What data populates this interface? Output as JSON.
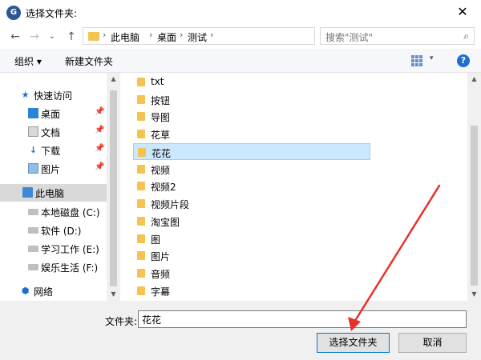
{
  "window": {
    "title": "选择文件夹:",
    "app_icon": "app-logo-icon",
    "close_glyph": "✕"
  },
  "nav": {
    "back": "←",
    "forward": "→",
    "recent": "⌄",
    "up": "↑"
  },
  "address": {
    "crumbs": [
      "此电脑",
      "桌面",
      "测试"
    ],
    "separator": "›",
    "dropdown": "⌄",
    "refresh": "↻"
  },
  "search": {
    "placeholder": "搜索\"测试\"",
    "icon": "⌕"
  },
  "toolbar": {
    "organize": "组织 ▾",
    "new_folder": "新建文件夹",
    "view_drop": "▾",
    "help": "?"
  },
  "sidebar": {
    "items": [
      {
        "label": "快速访问",
        "icon": "★"
      },
      {
        "label": "桌面",
        "icon": ""
      },
      {
        "label": "文档",
        "icon": ""
      },
      {
        "label": "下载",
        "icon": "↓"
      },
      {
        "label": "图片",
        "icon": ""
      },
      {
        "label": "此电脑",
        "icon": ""
      },
      {
        "label": "本地磁盘 (C:)",
        "icon": ""
      },
      {
        "label": "软件 (D:)",
        "icon": ""
      },
      {
        "label": "学习工作 (E:)",
        "icon": ""
      },
      {
        "label": "娱乐生活 (F:)",
        "icon": ""
      },
      {
        "label": "网络",
        "icon": "⬢"
      }
    ],
    "pin": "📌"
  },
  "scroll": {
    "up": "▲",
    "down": "▼"
  },
  "files": [
    "txt",
    "按钮",
    "导图",
    "花草",
    "花花",
    "视频",
    "视频2",
    "视频片段",
    "淘宝图",
    "图",
    "图片",
    "音频",
    "字幕"
  ],
  "selected_file": "花花",
  "footer": {
    "folder_label": "文件夹:",
    "folder_value": "花花",
    "select_button": "选择文件夹",
    "cancel_button": "取消"
  },
  "colors": {
    "annotation_arrow": "#e8312b",
    "selection": "#cce8ff",
    "folder": "#f4c451"
  }
}
